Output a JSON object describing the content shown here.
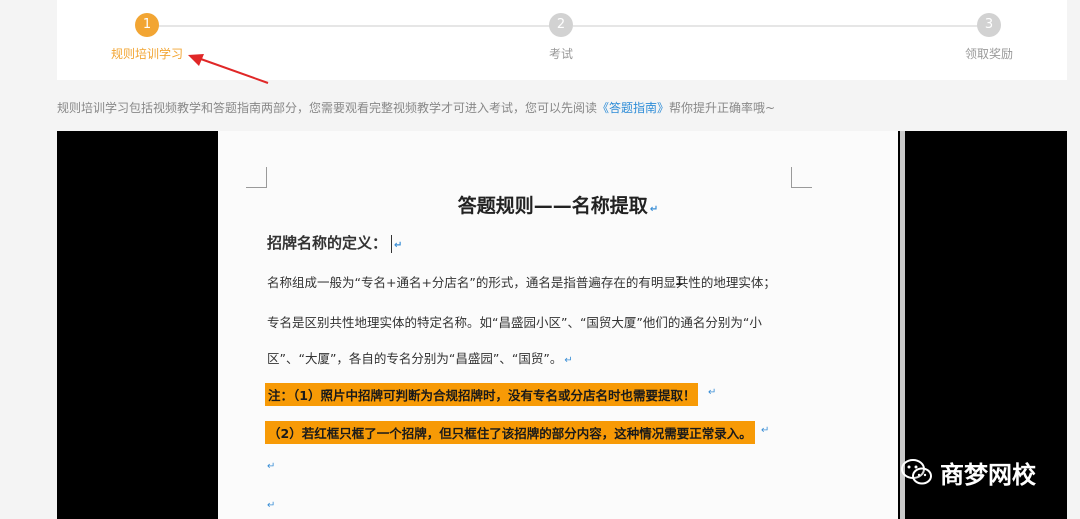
{
  "colors": {
    "accent": "#f2a533",
    "inactive_step": "#d2d2d2",
    "highlight": "#f79a06",
    "link": "#2d8cd7",
    "annotation_arrow": "#e02727"
  },
  "steps": [
    {
      "number": "1",
      "label": "规则培训学习",
      "active": true
    },
    {
      "number": "2",
      "label": "考试",
      "active": false
    },
    {
      "number": "3",
      "label": "领取奖励",
      "active": false
    }
  ],
  "description": {
    "before": "规则培训学习包括视频教学和答题指南两部分，您需要观看完整视频教学才可进入考试，您可以先阅读",
    "link": "《答题指南》",
    "after": "帮你提升正确率哦~"
  },
  "document": {
    "title": "答题规则——名称提取",
    "heading": "招牌名称的定义：",
    "para_mark": "↵",
    "paragraphs": [
      "名称组成一般为“专名+通名+分店名”的形式，通名是指普遍存在的有明显共性的地理实体；",
      "专名是区别共性地理实体的特定名称。如“昌盛园小区”、“国贸大厦”他们的通名分别为“小",
      "区”、“大厦”，各自的专名分别为“昌盛园”、“国贸”。"
    ],
    "notes": [
      "注：（1）照片中招牌可判断为合规招牌时，没有专名或分店名时也需要提取！",
      "（2）若红框只框了一个招牌，但只框住了该招牌的部分内容，这种情况需要正常录入。"
    ]
  },
  "watermark": {
    "text": "商梦网校",
    "icon": "wechat-icon"
  }
}
